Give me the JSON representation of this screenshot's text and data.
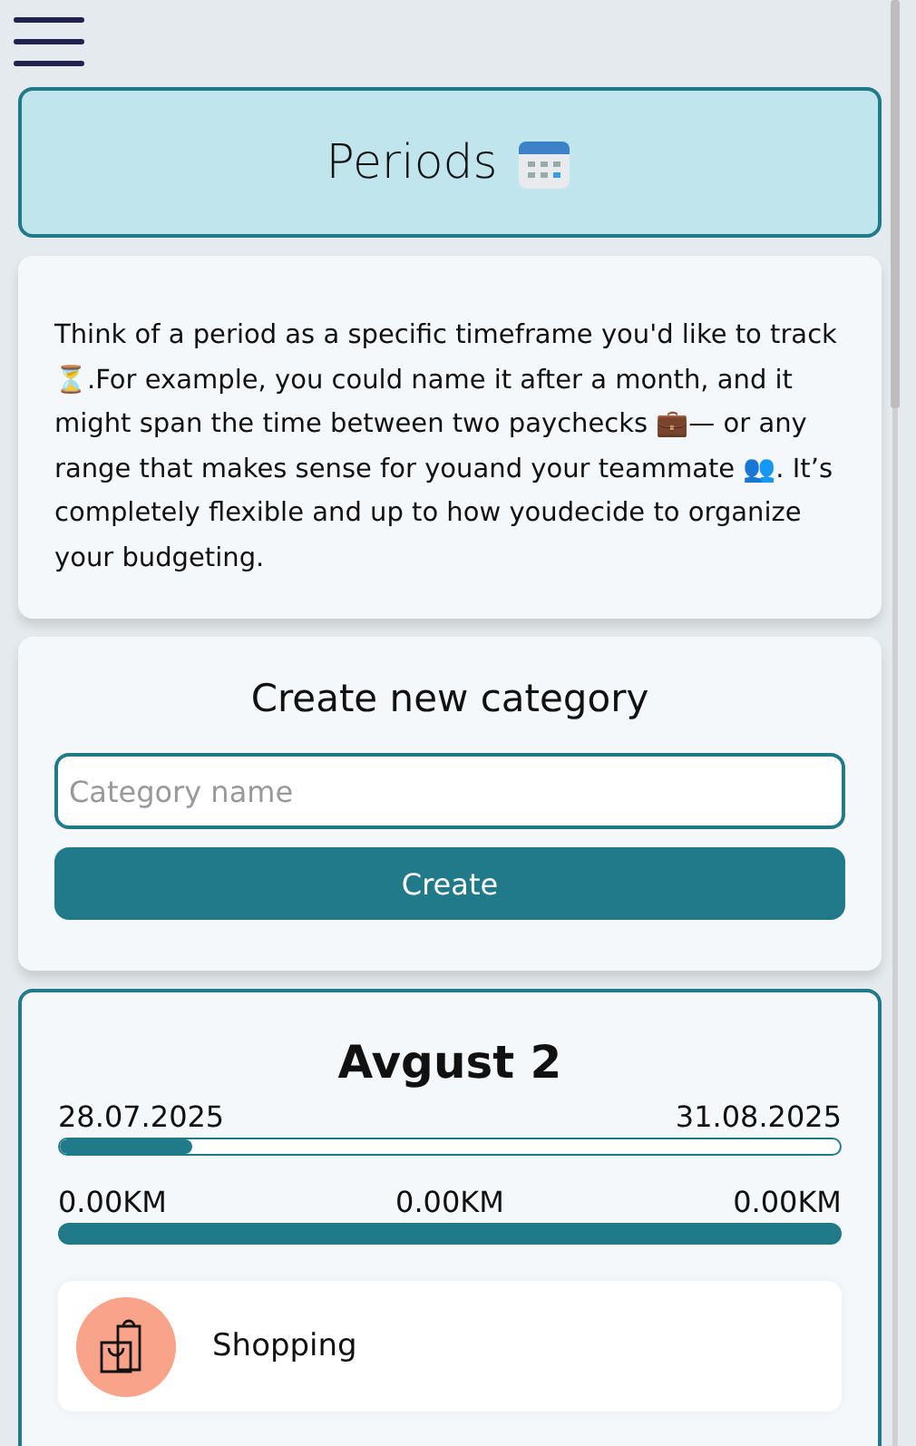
{
  "header": {
    "title": "Periods"
  },
  "intro": {
    "text": "Think of a period as a specific timeframe you'd like to track ⏳.For example, you could name it after a month, and it might span the time between two paychecks 💼— or any range that makes sense for youand your teammate 👥. It’s completely flexible and up to how youdecide to organize your budgeting."
  },
  "create_form": {
    "title": "Create new category",
    "placeholder": "Category name",
    "button": "Create"
  },
  "period": {
    "name": "Avgust 2",
    "start_date": "28.07.2025",
    "end_date": "31.08.2025",
    "time_bar": {
      "level": 0.17
    },
    "amounts": [
      "0.00KM",
      "0.00KM",
      "0.00KM"
    ],
    "categories": [
      {
        "name": "Shopping",
        "color": "#f9a48a"
      }
    ]
  }
}
